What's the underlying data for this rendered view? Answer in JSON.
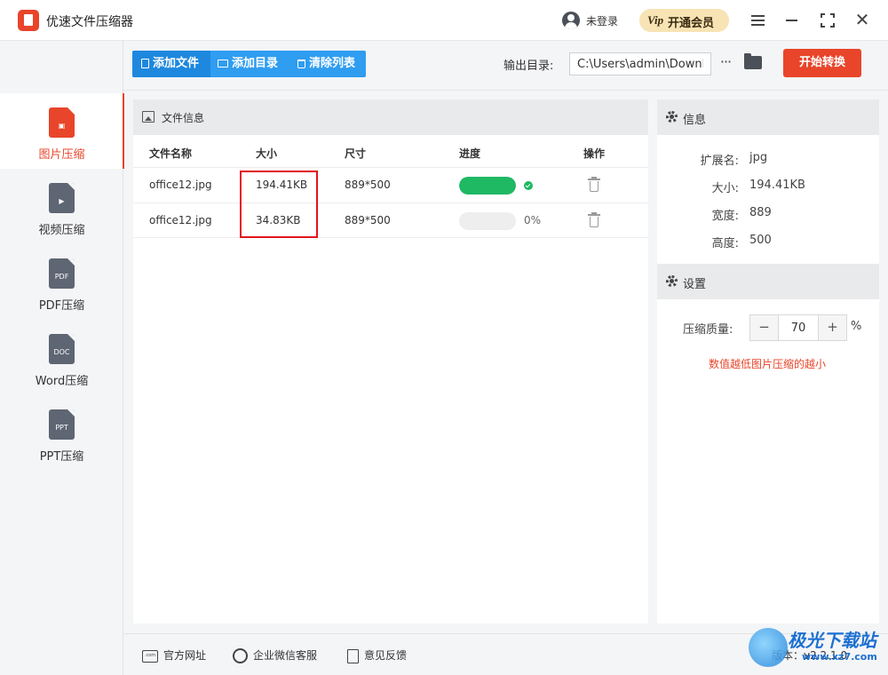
{
  "app": {
    "title": "优速文件压缩器"
  },
  "titlebar": {
    "login_text": "未登录",
    "vip_icon": "Vip",
    "vip_label": "开通会员"
  },
  "sidebar": {
    "items": [
      {
        "label": "图片压缩",
        "glyph": "▣",
        "icon": "image-file-icon",
        "active": true
      },
      {
        "label": "视频压缩",
        "glyph": "▶",
        "icon": "video-file-icon",
        "active": false
      },
      {
        "label": "PDF压缩",
        "glyph": "PDF",
        "icon": "pdf-file-icon",
        "active": false
      },
      {
        "label": "Word压缩",
        "glyph": "DOC",
        "icon": "doc-file-icon",
        "active": false
      },
      {
        "label": "PPT压缩",
        "glyph": "PPT",
        "icon": "ppt-file-icon",
        "active": false
      }
    ]
  },
  "toolbar": {
    "add_file": "添加文件",
    "add_dir": "添加目录",
    "clear_list": "清除列表",
    "output_label": "输出目录:",
    "output_path": "C:\\Users\\admin\\Downloads",
    "start_button": "开始转换"
  },
  "file_panel": {
    "title": "文件信息",
    "columns": [
      "文件名称",
      "大小",
      "尺寸",
      "进度",
      "操作"
    ],
    "rows": [
      {
        "name": "office12.jpg",
        "size": "194.41KB",
        "dimensions": "889*500",
        "progress": 1.0,
        "progress_text": "",
        "status": "done"
      },
      {
        "name": "office12.jpg",
        "size": "34.83KB",
        "dimensions": "889*500",
        "progress": 0,
        "progress_text": "0%",
        "status": "pending"
      }
    ]
  },
  "info_panel": {
    "title": "信息",
    "rows": [
      {
        "key": "扩展名:",
        "value": "jpg"
      },
      {
        "key": "大小:",
        "value": "194.41KB"
      },
      {
        "key": "宽度:",
        "value": "889"
      },
      {
        "key": "高度:",
        "value": "500"
      }
    ]
  },
  "settings_panel": {
    "title": "设置",
    "quality_label": "压缩质量:",
    "quality_value": "70",
    "percent_sign": "%",
    "tip": "数值越低图片压缩的越小"
  },
  "footer": {
    "website": "官方网址",
    "wechat": "企业微信客服",
    "feedback": "意见反馈",
    "version": "版本：v2.2.1.0"
  },
  "watermark": {
    "text": "极光下载站",
    "url": "www.xz7.com"
  },
  "colors": {
    "accent": "#e8452a",
    "primary": "#2f9df0",
    "success": "#1fb863",
    "highlight": "#e0151c"
  }
}
